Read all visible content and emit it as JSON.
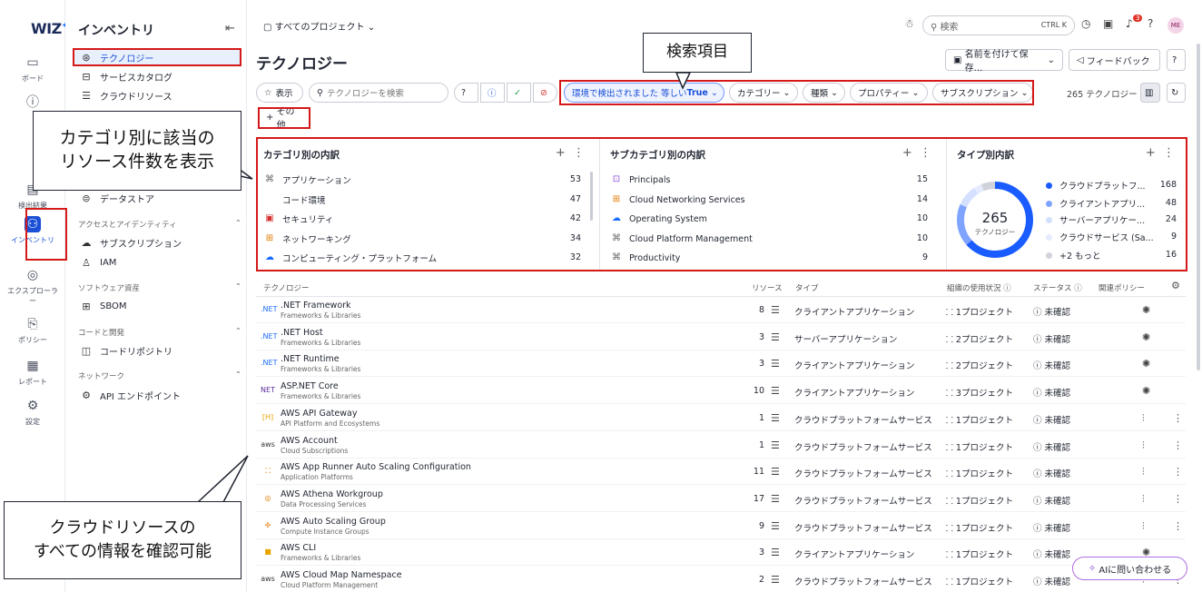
{
  "rail": {
    "logo": "WIZ",
    "items": [
      {
        "label": "ボード",
        "icon": "board-icon",
        "glyph": "▭"
      },
      {
        "label": "",
        "icon": "alert-icon",
        "glyph": "ⓘ"
      },
      {
        "label": "検出結果",
        "icon": "findings-icon",
        "glyph": "▤"
      },
      {
        "label": "インベントリ",
        "icon": "inventory-icon",
        "glyph": "⚇"
      },
      {
        "label": "エクスプローラー",
        "icon": "explorer-icon",
        "glyph": "◎"
      },
      {
        "label": "ポリシー",
        "icon": "policy-icon",
        "glyph": "⎘"
      },
      {
        "label": "レポート",
        "icon": "report-icon",
        "glyph": "▦"
      },
      {
        "label": "設定",
        "icon": "settings-icon",
        "glyph": "⚙"
      }
    ]
  },
  "sidebar": {
    "title": "インベントリ",
    "items": [
      {
        "label": "テクノロジー",
        "glyph": "⊛"
      },
      {
        "label": "サービスカタログ",
        "glyph": "⊟"
      },
      {
        "label": "クラウドリソース",
        "glyph": "☰"
      },
      {
        "label": "データストア",
        "glyph": "⊜"
      },
      {
        "label": "サブスクリプション",
        "glyph": "☁"
      },
      {
        "label": "IAM",
        "glyph": "♙"
      },
      {
        "label": "SBOM",
        "glyph": "⊞"
      },
      {
        "label": "コードリポジトリ",
        "glyph": "◫"
      },
      {
        "label": "API エンドポイント",
        "glyph": "⚙"
      }
    ],
    "sections": [
      "アクセスとアイデンティティ",
      "ソフトウェア資産",
      "コードと開発",
      "ネットワーク"
    ]
  },
  "topbar": {
    "project": "すべてのプロジェクト",
    "search_placeholder": "検索",
    "shortcut": "CTRL K",
    "notification_count": "3",
    "avatar": "ME"
  },
  "page": {
    "title": "テクノロジー",
    "save_button": "名前を付けて保存...",
    "feedback_button": "フィードバック"
  },
  "filters": {
    "show": "表示",
    "search_placeholder": "テクノロジーを検索",
    "detected_prefix": "環境で検出されました 等しい ",
    "detected_value": "True",
    "category": "カテゴリー",
    "kind": "種類",
    "property": "プロパティー",
    "subscription": "サブスクリプション",
    "count": "265 テクノロジー",
    "more": "その他"
  },
  "cards": {
    "category": {
      "title": "カテゴリ別の内訳",
      "rows": [
        {
          "label": "アプリケーション",
          "value": "53"
        },
        {
          "label": "コード環境",
          "value": "47"
        },
        {
          "label": "セキュリティ",
          "value": "42"
        },
        {
          "label": "ネットワーキング",
          "value": "34"
        },
        {
          "label": "コンピューティング・プラットフォーム",
          "value": "32"
        }
      ]
    },
    "subcategory": {
      "title": "サブカテゴリ別の内訳",
      "rows": [
        {
          "label": "Principals",
          "value": "15"
        },
        {
          "label": "Cloud Networking Services",
          "value": "14"
        },
        {
          "label": "Operating System",
          "value": "10"
        },
        {
          "label": "Cloud Platform Management",
          "value": "10"
        },
        {
          "label": "Productivity",
          "value": "9"
        }
      ]
    },
    "type": {
      "title": "タイプ別内訳",
      "total": "265",
      "total_label": "テクノロジー",
      "rows": [
        {
          "label": "クラウドプラットフ...",
          "value": "168",
          "color": "#1a5cff"
        },
        {
          "label": "クライアントアプリ...",
          "value": "48",
          "color": "#7fa4ff"
        },
        {
          "label": "サーバーアプリケー...",
          "value": "24",
          "color": "#d4e0ff"
        },
        {
          "label": "クラウドサービス (Sa...",
          "value": "9",
          "color": "#e6ecff"
        },
        {
          "label": "+2 もっと",
          "value": "16",
          "color": "#d0d3da"
        }
      ]
    }
  },
  "table": {
    "headers": {
      "tech": "テクノロジー",
      "resources": "リソース",
      "type": "タイプ",
      "usage": "組織の使用状況",
      "status": "ステータス",
      "policy": "関連ポリシー"
    },
    "rows": [
      {
        "name": ".NET Framework",
        "sub": "Frameworks & Libraries",
        "res": "8",
        "type": "クライアントアプリケーション",
        "usage": "1プロジェクト",
        "status": "未確認",
        "icon": ".NET"
      },
      {
        "name": ".NET Host",
        "sub": "Frameworks & Libraries",
        "res": "3",
        "type": "サーバーアプリケーション",
        "usage": "2プロジェクト",
        "status": "未確認",
        "icon": ".NET"
      },
      {
        "name": ".NET Runtime",
        "sub": "Frameworks & Libraries",
        "res": "3",
        "type": "クライアントアプリケーション",
        "usage": "2プロジェクト",
        "status": "未確認",
        "icon": ".NET"
      },
      {
        "name": "ASP.NET Core",
        "sub": "Frameworks & Libraries",
        "res": "10",
        "type": "クライアントアプリケーション",
        "usage": "3プロジェクト",
        "status": "未確認",
        "icon": "NET"
      },
      {
        "name": "AWS API Gateway",
        "sub": "API Platform and Ecosystems",
        "res": "1",
        "type": "クラウドプラットフォームサービス",
        "usage": "1プロジェクト",
        "status": "未確認",
        "icon": "[H]"
      },
      {
        "name": "AWS Account",
        "sub": "Cloud Subscriptions",
        "res": "1",
        "type": "クラウドプラットフォームサービス",
        "usage": "1プロジェクト",
        "status": "未確認",
        "icon": "aws"
      },
      {
        "name": "AWS App Runner Auto Scaling Configuration",
        "sub": "Application Platforms",
        "res": "11",
        "type": "クラウドプラットフォームサービス",
        "usage": "1プロジェクト",
        "status": "未確認",
        "icon": "⛶"
      },
      {
        "name": "AWS Athena Workgroup",
        "sub": "Data Processing Services",
        "res": "17",
        "type": "クラウドプラットフォームサービス",
        "usage": "1プロジェクト",
        "status": "未確認",
        "icon": "◎"
      },
      {
        "name": "AWS Auto Scaling Group",
        "sub": "Compute Instance Groups",
        "res": "9",
        "type": "クラウドプラットフォームサービス",
        "usage": "1プロジェクト",
        "status": "未確認",
        "icon": "✣"
      },
      {
        "name": "AWS CLI",
        "sub": "Frameworks & Libraries",
        "res": "3",
        "type": "クライアントアプリケーション",
        "usage": "1プロジェクト",
        "status": "未確認",
        "icon": "■"
      },
      {
        "name": "AWS Cloud Map Namespace",
        "sub": "Cloud Platform Management",
        "res": "2",
        "type": "クラウドプラットフォームサービス",
        "usage": "1プロジェクト",
        "status": "未確認",
        "icon": "aws"
      }
    ]
  },
  "callouts": {
    "search": "検索項目",
    "category": "カテゴリ別に該当の\nリソース件数を表示",
    "cloud": "クラウドリソースの\nすべての情報を確認可能"
  },
  "ai_button": "AIに問い合わせる",
  "colors": {
    "accent": "#1a4fd6",
    "highlight": "#d51818"
  }
}
